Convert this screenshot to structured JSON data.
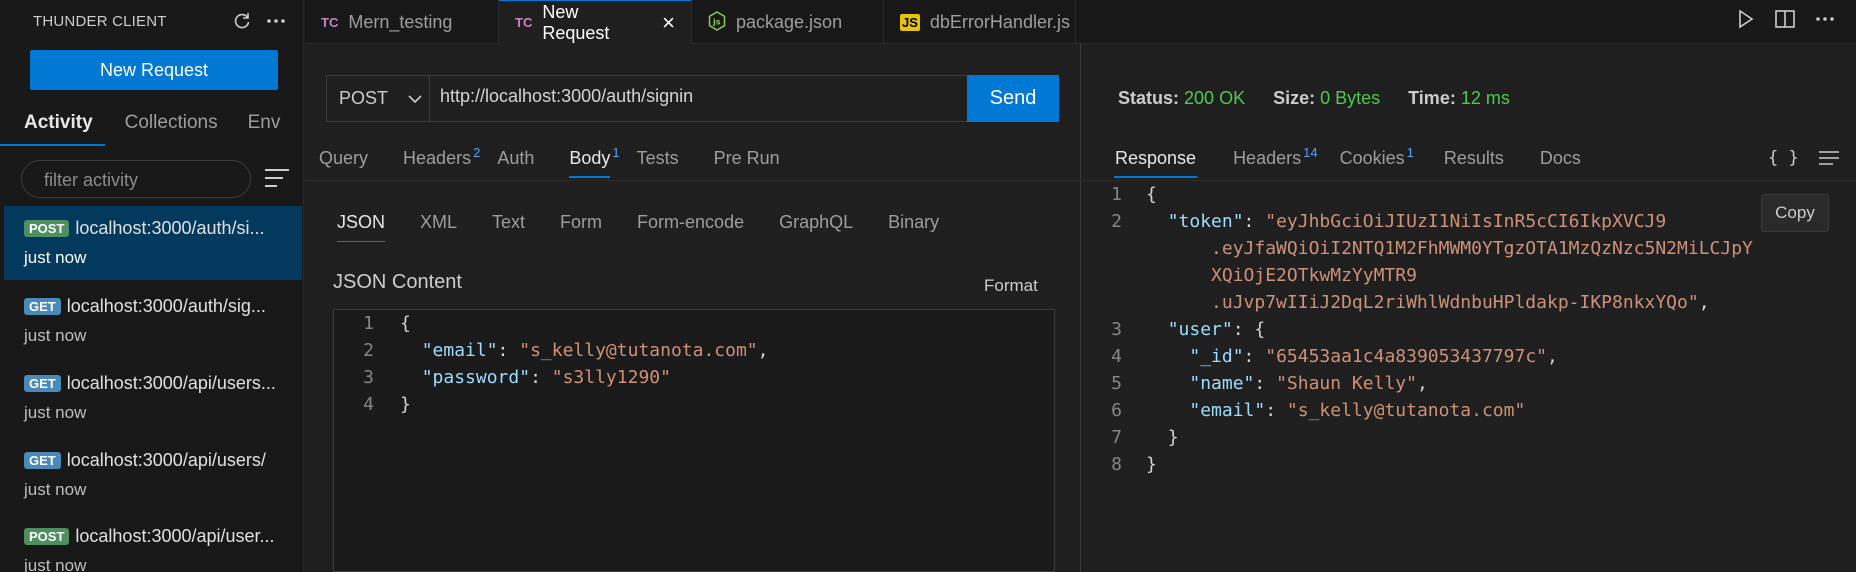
{
  "sidebar": {
    "title": "THUNDER CLIENT",
    "new_request": "New Request",
    "tabs": [
      "Activity",
      "Collections",
      "Env"
    ],
    "filter_placeholder": "filter activity",
    "activity": [
      {
        "method": "POST",
        "url": "localhost:3000/auth/si...",
        "time": "just now",
        "selected": true
      },
      {
        "method": "GET",
        "url": "localhost:3000/auth/sig...",
        "time": "just now"
      },
      {
        "method": "GET",
        "url": "localhost:3000/api/users...",
        "time": "just now"
      },
      {
        "method": "GET",
        "url": "localhost:3000/api/users/",
        "time": "just now"
      },
      {
        "method": "POST",
        "url": "localhost:3000/api/user...",
        "time": "just now"
      }
    ]
  },
  "editor_tabs": [
    {
      "icon": "TC",
      "label": "Mern_testing"
    },
    {
      "icon": "TC",
      "label": "New Request",
      "active": true
    },
    {
      "icon": "nodejs-icon",
      "label": "package.json"
    },
    {
      "icon": "JS",
      "label": "dbErrorHandler.js"
    }
  ],
  "request": {
    "method": "POST",
    "url": "http://localhost:3000/auth/signin",
    "send": "Send",
    "tabs": [
      {
        "label": "Query"
      },
      {
        "label": "Headers",
        "count": "2"
      },
      {
        "label": "Auth"
      },
      {
        "label": "Body",
        "count": "1",
        "active": true
      },
      {
        "label": "Tests"
      },
      {
        "label": "Pre Run"
      }
    ],
    "body_tabs": [
      "JSON",
      "XML",
      "Text",
      "Form",
      "Form-encode",
      "GraphQL",
      "Binary"
    ],
    "json_title": "JSON Content",
    "format": "Format",
    "body_lines": [
      {
        "n": "1",
        "indent": "",
        "key": "",
        "val": "",
        "pre": "{",
        "post": ""
      },
      {
        "n": "2",
        "indent": "  ",
        "key": "\"email\"",
        "val": "\"s_kelly@tutanota.com\"",
        "pre": "",
        "post": ","
      },
      {
        "n": "3",
        "indent": "  ",
        "key": "\"password\"",
        "val": "\"s3lly1290\"",
        "pre": "",
        "post": ""
      },
      {
        "n": "4",
        "indent": "",
        "key": "",
        "val": "",
        "pre": "}",
        "post": ""
      }
    ]
  },
  "response": {
    "status_label": "Status:",
    "status": "200 OK",
    "size_label": "Size:",
    "size": "0 Bytes",
    "time_label": "Time:",
    "time": "12 ms",
    "tabs": [
      {
        "label": "Response",
        "active": true
      },
      {
        "label": "Headers",
        "count": "14"
      },
      {
        "label": "Cookies",
        "count": "1"
      },
      {
        "label": "Results"
      },
      {
        "label": "Docs"
      }
    ],
    "braces": "{ }",
    "copy": "Copy",
    "lines": [
      {
        "n": "1",
        "indent": "",
        "key": "",
        "val": "",
        "pre": "{",
        "post": ""
      },
      {
        "n": "2",
        "indent": "  ",
        "key": "\"token\"",
        "val": "\"eyJhbGciOiJIUzI1NiIsInR5cCI6IkpXVCJ9",
        "pre": "",
        "post": ""
      },
      {
        "n": "",
        "indent": "      ",
        "key": "",
        "val": ".eyJfaWQiOiI2NTQ1M2FhMWM0YTgzOTA1MzQzNzc5N2MiLCJpY",
        "pre": "",
        "post": ""
      },
      {
        "n": "",
        "indent": "      ",
        "key": "",
        "val": "XQiOjE2OTkwMzYyMTR9",
        "pre": "",
        "post": ""
      },
      {
        "n": "",
        "indent": "      ",
        "key": "",
        "val": ".uJvp7wIIiJ2DqL2riWhlWdnbuHPldakp-IKP8nkxYQo\"",
        "pre": "",
        "post": ","
      },
      {
        "n": "3",
        "indent": "  ",
        "key": "\"user\"",
        "val": "",
        "pre": "",
        "post": "{"
      },
      {
        "n": "4",
        "indent": "    ",
        "key": "\"_id\"",
        "val": "\"65453aa1c4a839053437797c\"",
        "pre": "",
        "post": ","
      },
      {
        "n": "5",
        "indent": "    ",
        "key": "\"name\"",
        "val": "\"Shaun Kelly\"",
        "pre": "",
        "post": ","
      },
      {
        "n": "6",
        "indent": "    ",
        "key": "\"email\"",
        "val": "\"s_kelly@tutanota.com\"",
        "pre": "",
        "post": ""
      },
      {
        "n": "7",
        "indent": "  ",
        "key": "",
        "val": "",
        "pre": "}",
        "post": ""
      },
      {
        "n": "8",
        "indent": "",
        "key": "",
        "val": "",
        "pre": "}",
        "post": ""
      }
    ]
  }
}
